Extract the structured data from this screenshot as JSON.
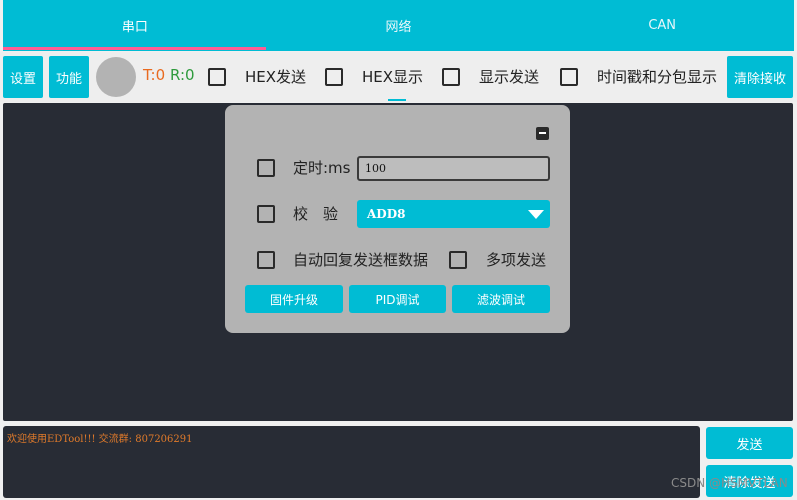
{
  "tabs": [
    {
      "label": "串口",
      "active": true
    },
    {
      "label": "网络",
      "active": false
    },
    {
      "label": "CAN",
      "active": false
    }
  ],
  "toolbar": {
    "settings_label": "设置",
    "function_label": "功能",
    "tx_count": "T:0",
    "rx_count": "R:0",
    "hex_send_label": "HEX发送",
    "hex_display_label": "HEX显示",
    "show_send_label": "显示发送",
    "timestamp_label": "时间戳和分包显示",
    "clear_recv_label": "清除接收"
  },
  "panel": {
    "timer_label": "定时:ms",
    "timer_value": "100",
    "checksum_label": "校　验",
    "checksum_selected": "ADD8",
    "auto_reply_label": "自动回复发送框数据",
    "multi_send_label": "多项发送",
    "firmware_label": "固件升级",
    "pid_label": "PID调试",
    "filter_label": "滤波调试"
  },
  "send": {
    "text": "欢迎使用EDTool!!! 交流群: 807206291",
    "send_label": "发送",
    "clear_send_label": "清除发送"
  },
  "watermark": "CSDN @HSMVTLAN",
  "colors": {
    "accent": "#00bcd4",
    "tab_indicator": "#ff5c93",
    "dark_bg": "#282c35",
    "tx_color": "#e96a1f",
    "rx_color": "#2e9a3c",
    "send_text": "#e07a2a"
  }
}
